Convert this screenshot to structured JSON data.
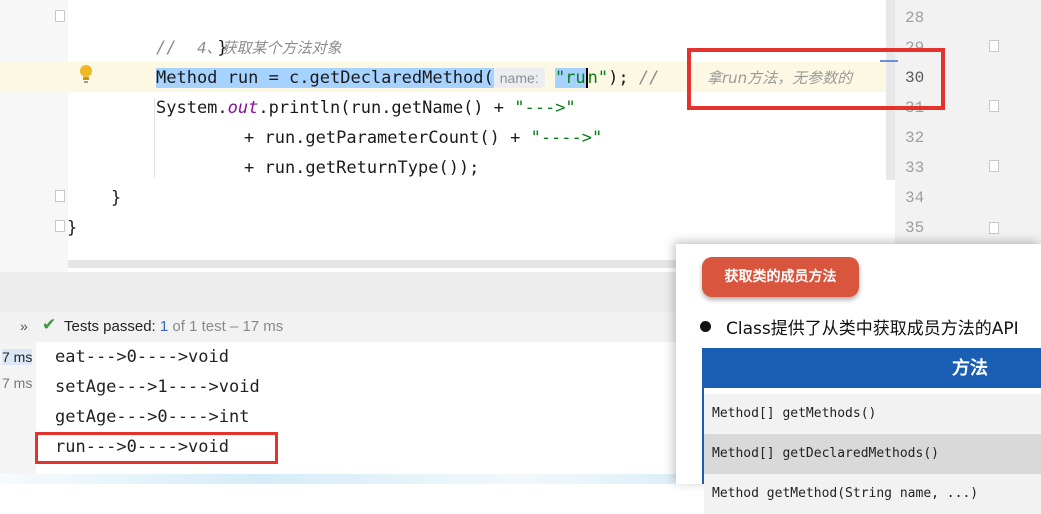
{
  "editor": {
    "line_numbers": [
      "28",
      "29",
      "30",
      "31",
      "32",
      "33",
      "34",
      "35"
    ],
    "code": {
      "brace_close_1": "}",
      "comment_prefix": "//",
      "comment_step": "4、获取某个方法对象",
      "line_method_decl": "Method run = c.getDeclaredMethod(",
      "param_hint": "name:",
      "string_run_open": "\"ru",
      "string_run_close": "n\"",
      "stmt_end": ");",
      "trailing_comment_prefix": "//",
      "trailing_comment_text": "拿run方法，无参数的",
      "println_prefix": "System.",
      "println_out": "out",
      "println_rest": ".println(run.getName() + ",
      "arrow_3": "\"--->\"",
      "count_expr": "+ run.getParameterCount() + ",
      "arrow_4": "\"---->\"",
      "return_expr": "+ run.getReturnType());",
      "brace_close_2": "}",
      "brace_close_3": "}"
    }
  },
  "run_panel": {
    "tests_label": "Tests passed: ",
    "passed_count": "1",
    "of_label": " of ",
    "total": "1 test",
    "duration": " – 17 ms",
    "timings": [
      "7 ms",
      "7 ms"
    ],
    "output_lines": [
      "eat--->0---->void",
      "setAge--->1---->void",
      "getAge--->0---->int",
      "run--->0---->void"
    ]
  },
  "slide": {
    "heading": "获取类的成员方法",
    "bullet_text": "Class提供了从类中获取成员方法的API",
    "table_header": "方法",
    "table_rows": [
      "Method[] getMethods()",
      "Method[] getDeclaredMethods()",
      "Method getMethod(String name, ...)"
    ]
  },
  "colors": {
    "selection": "#a6d2ff",
    "highlight_box": "#e5322d",
    "slide_accent": "#d9553e",
    "table_header": "#1a5fb4"
  }
}
